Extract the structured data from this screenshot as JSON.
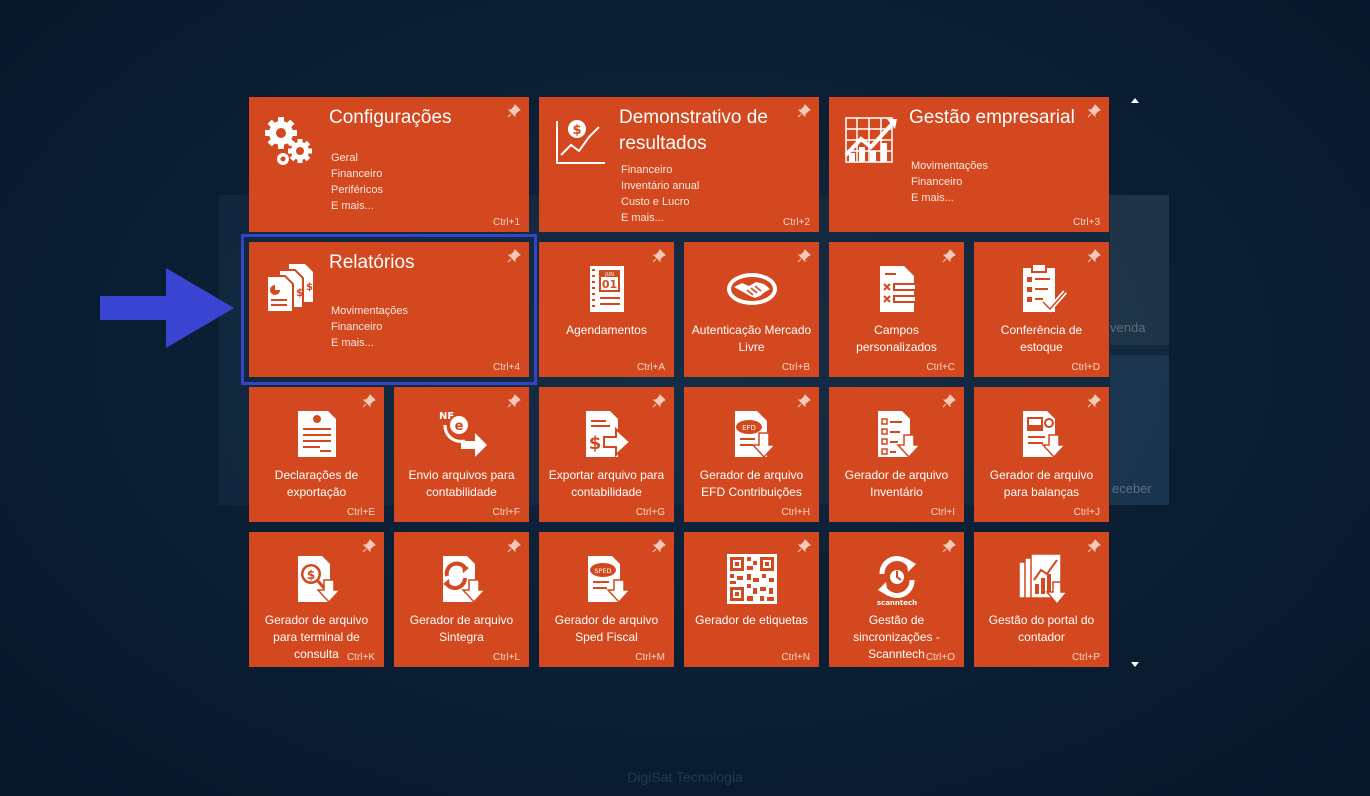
{
  "footer": "DigiSat Tecnologia",
  "background": {
    "label_venda": "venda",
    "label_receber": "eceber"
  },
  "tiles": {
    "configuracoes": {
      "title": "Configurações",
      "items": [
        "Geral",
        "Financeiro",
        "Periféricos",
        "E mais..."
      ],
      "shortcut": "Ctrl+1"
    },
    "demonstrativo": {
      "title": "Demonstrativo de resultados",
      "items": [
        "Financeiro",
        "Inventário anual",
        "Custo e Lucro",
        "E mais..."
      ],
      "shortcut": "Ctrl+2"
    },
    "gestao_empresarial": {
      "title": "Gestão empresarial",
      "items": [
        "Movimentações",
        "Financeiro",
        "E mais..."
      ],
      "shortcut": "Ctrl+3"
    },
    "relatorios": {
      "title": "Relatórios",
      "items": [
        "Movimentações",
        "Financeiro",
        "E mais..."
      ],
      "shortcut": "Ctrl+4"
    },
    "agendamentos": {
      "label": "Agendamentos",
      "shortcut": "Ctrl+A",
      "icon": "calendar-icon",
      "cal_month": "JUN",
      "cal_day": "01"
    },
    "mercado_livre": {
      "label": "Autenticação Mercado Livre",
      "shortcut": "Ctrl+B",
      "icon": "handshake-icon"
    },
    "campos": {
      "label": "Campos personalizados",
      "shortcut": "Ctrl+C",
      "icon": "form-fields-icon"
    },
    "conferencia": {
      "label": "Conferência de estoque",
      "shortcut": "Ctrl+D",
      "icon": "clipboard-check-icon"
    },
    "declaracoes": {
      "label": "Declarações de exportação",
      "shortcut": "Ctrl+E",
      "icon": "certificate-icon"
    },
    "envio": {
      "label": "Envio arquivos para contabilidade",
      "shortcut": "Ctrl+F",
      "icon": "nfe-send-icon",
      "nf_text": "NF"
    },
    "exportar": {
      "label": "Exportar arquivo para contabilidade",
      "shortcut": "Ctrl+G",
      "icon": "export-money-icon"
    },
    "efd": {
      "label": "Gerador de arquivo EFD Contribuições",
      "shortcut": "Ctrl+H",
      "icon": "efd-file-icon",
      "badge": "EFD"
    },
    "inventario": {
      "label": "Gerador de arquivo Inventário",
      "shortcut": "Ctrl+I",
      "icon": "inventory-file-icon"
    },
    "balancas": {
      "label": "Gerador de arquivo para balanças",
      "shortcut": "Ctrl+J",
      "icon": "scale-file-icon"
    },
    "terminal": {
      "label": "Gerador de arquivo para terminal de consulta",
      "shortcut": "Ctrl+K",
      "icon": "terminal-file-icon"
    },
    "sintegra": {
      "label": "Gerador de arquivo Sintegra",
      "shortcut": "Ctrl+L",
      "icon": "sintegra-file-icon"
    },
    "sped": {
      "label": "Gerador de arquivo Sped Fiscal",
      "shortcut": "Ctrl+M",
      "icon": "sped-file-icon",
      "badge": "SPED"
    },
    "etiquetas": {
      "label": "Gerador de etiquetas",
      "shortcut": "Ctrl+N",
      "icon": "qr-code-icon"
    },
    "scanntech": {
      "label": "Gestão de sincronizações - Scanntech",
      "shortcut": "Ctrl+O",
      "icon": "sync-icon",
      "logo_text": "scanntech"
    },
    "portal": {
      "label": "Gestão do portal do contador",
      "shortcut": "Ctrl+P",
      "icon": "chart-documents-icon"
    }
  }
}
